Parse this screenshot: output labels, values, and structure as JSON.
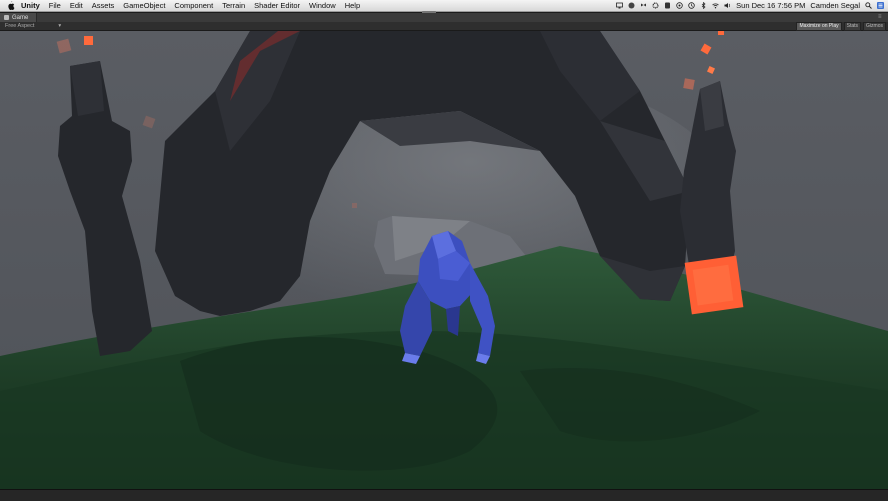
{
  "menubar": {
    "apple_icon": "apple-icon",
    "items": [
      "Unity",
      "File",
      "Edit",
      "Assets",
      "GameObject",
      "Component",
      "Terrain",
      "Shader Editor",
      "Window",
      "Help"
    ],
    "clock": "Sun Dec 16  7:56 PM",
    "user": "Camden Segal",
    "status_icons": [
      "screen-icon",
      "cloud-icon",
      "dropbox-icon",
      "gear-icon",
      "evernote-icon",
      "at-icon",
      "timemachine-icon",
      "bluetooth-icon",
      "wifi-icon",
      "volume-icon",
      "search-icon",
      "list-icon"
    ]
  },
  "tab": {
    "label": "Game",
    "icon": "game-icon"
  },
  "toolbar": {
    "aspect": "Free Aspect",
    "buttons": [
      "Maximize on Play",
      "Stats",
      "Gizmos"
    ]
  },
  "colors": {
    "sky": "#55585e",
    "ground": "#1f4a2c",
    "rock": "#26282d",
    "character": "#3c4fbf",
    "particle": "#ff6a3c"
  }
}
